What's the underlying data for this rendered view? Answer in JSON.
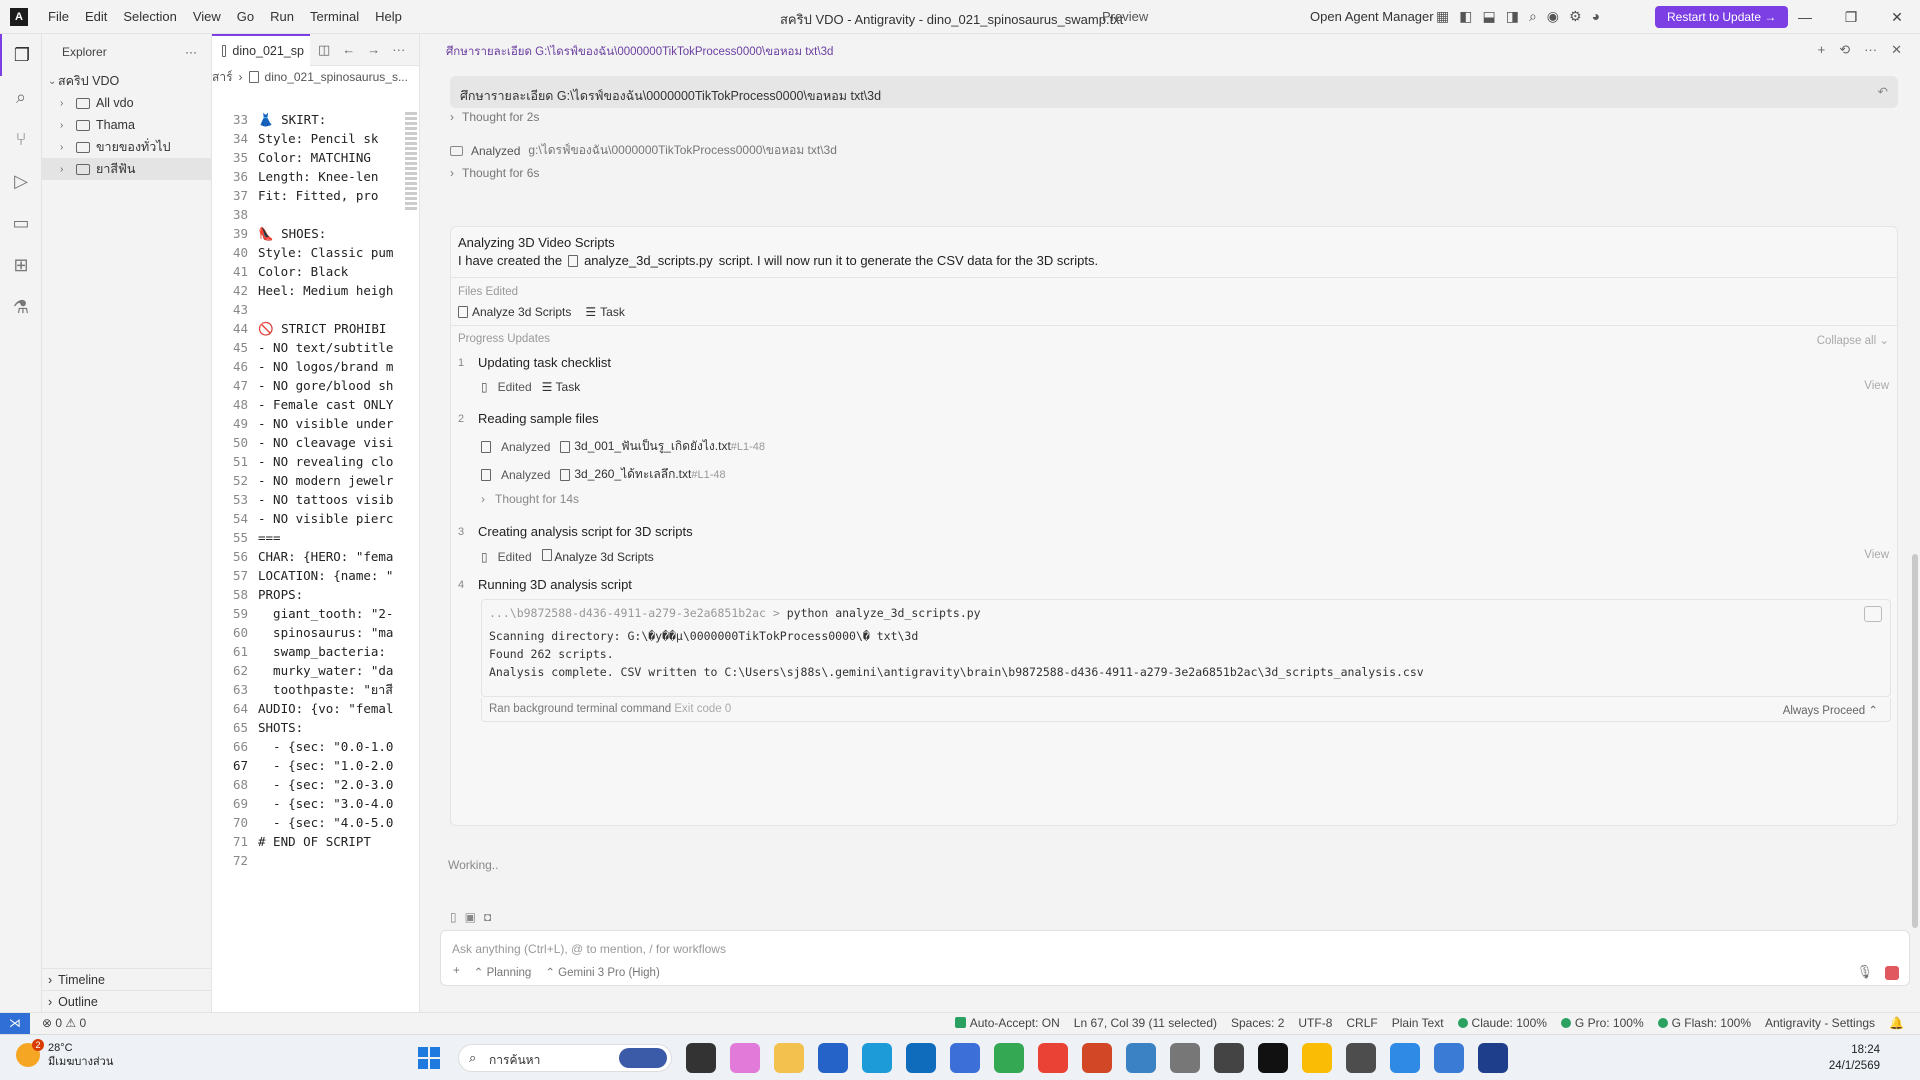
{
  "titlebar": {
    "menu": [
      "File",
      "Edit",
      "Selection",
      "View",
      "Go",
      "Run",
      "Terminal",
      "Help"
    ],
    "title": "สคริป VDO - Antigravity - dino_021_spinosaurus_swamp.txt",
    "preview": "Preview",
    "agent_manager": "Open Agent Manager",
    "restart": "Restart to Update →"
  },
  "sidebar": {
    "title": "Explorer",
    "root": "สคริป VDO",
    "items": [
      {
        "label": "All vdo"
      },
      {
        "label": "Thama"
      },
      {
        "label": "ขายของทั่วไป"
      },
      {
        "label": "ยาสีฟัน"
      }
    ],
    "timeline": "Timeline",
    "outline": "Outline"
  },
  "editor": {
    "tab": "dino_021_sp",
    "breadcrumb_1": "สาร์",
    "breadcrumb_2": "dino_021_spinosaurus_s...",
    "current_line": 67,
    "lines": [
      {
        "n": 33,
        "t": "👗 SKIRT:"
      },
      {
        "n": 34,
        "t": "Style: Pencil sk"
      },
      {
        "n": 35,
        "t": "Color: MATCHING "
      },
      {
        "n": 36,
        "t": "Length: Knee-len"
      },
      {
        "n": 37,
        "t": "Fit: Fitted, pro"
      },
      {
        "n": 38,
        "t": ""
      },
      {
        "n": 39,
        "t": "👠 SHOES:"
      },
      {
        "n": 40,
        "t": "Style: Classic pum"
      },
      {
        "n": 41,
        "t": "Color: Black"
      },
      {
        "n": 42,
        "t": "Heel: Medium heigh"
      },
      {
        "n": 43,
        "t": ""
      },
      {
        "n": 44,
        "t": "🚫 STRICT PROHIBI"
      },
      {
        "n": 45,
        "t": "- NO text/subtitle"
      },
      {
        "n": 46,
        "t": "- NO logos/brand m"
      },
      {
        "n": 47,
        "t": "- NO gore/blood sh"
      },
      {
        "n": 48,
        "t": "- Female cast ONLY"
      },
      {
        "n": 49,
        "t": "- NO visible under"
      },
      {
        "n": 50,
        "t": "- NO cleavage visi"
      },
      {
        "n": 51,
        "t": "- NO revealing clo"
      },
      {
        "n": 52,
        "t": "- NO modern jewelr"
      },
      {
        "n": 53,
        "t": "- NO tattoos visib"
      },
      {
        "n": 54,
        "t": "- NO visible pierc"
      },
      {
        "n": 55,
        "t": "==="
      },
      {
        "n": 56,
        "t": "CHAR: {HERO: \"fema"
      },
      {
        "n": 57,
        "t": "LOCATION: {name: \""
      },
      {
        "n": 58,
        "t": "PROPS:"
      },
      {
        "n": 59,
        "t": "  giant_tooth: \"2-"
      },
      {
        "n": 60,
        "t": "  spinosaurus: \"ma"
      },
      {
        "n": 61,
        "t": "  swamp_bacteria:"
      },
      {
        "n": 62,
        "t": "  murky_water: \"da"
      },
      {
        "n": 63,
        "t": "  toothpaste: \"ยาสี"
      },
      {
        "n": 64,
        "t": "AUDIO: {vo: \"femal"
      },
      {
        "n": 65,
        "t": "SHOTS:"
      },
      {
        "n": 66,
        "t": "  - {sec: \"0.0-1.0"
      },
      {
        "n": 67,
        "t": "  - {sec: \"1.0-2.0"
      },
      {
        "n": 68,
        "t": "  - {sec: \"2.0-3.0"
      },
      {
        "n": 69,
        "t": "  - {sec: \"3.0-4.0"
      },
      {
        "n": 70,
        "t": "  - {sec: \"4.0-5.0"
      },
      {
        "n": 71,
        "t": "# END OF SCRIPT"
      },
      {
        "n": 72,
        "t": ""
      }
    ]
  },
  "agent": {
    "header": "ศึกษารายละเอียด G:\\ไดรฟ์ของฉัน\\0000000TikTokProcess0000\\ขอหอม txt\\3d",
    "query": "ศึกษารายละเอียด G:\\ไดรฟ์ของฉัน\\0000000TikTokProcess0000\\ขอหอม txt\\3d",
    "thought1": "Thought for 2s",
    "analyzed_label": "Analyzed",
    "analyzed_path": "g:\\ไดรฟ์ของฉัน\\0000000TikTokProcess0000\\ขอหอม txt\\3d",
    "thought2": "Thought for 6s",
    "card_title": "Analyzing 3D Video Scripts",
    "card_desc_pre": "I have created the",
    "card_desc_file": "analyze_3d_scripts.py",
    "card_desc_post": "script. I will now run it to generate the CSV data for the 3D scripts.",
    "files_edited_label": "Files Edited",
    "file_chip_1": "Analyze 3d Scripts",
    "file_chip_2": "Task",
    "progress_label": "Progress Updates",
    "collapse_all": "Collapse all",
    "steps": [
      {
        "num": "1",
        "title": "Updating task checklist"
      },
      {
        "num": "2",
        "title": "Reading sample files"
      },
      {
        "num": "3",
        "title": "Creating analysis script for 3D scripts"
      },
      {
        "num": "4",
        "title": "Running 3D analysis script"
      }
    ],
    "s1_action": "Edited",
    "s1_target": "Task",
    "view_label": "View",
    "s2_a_action": "Analyzed",
    "s2_a_file": "3d_001_ฟันเป็นรู_เกิดยังไง.txt",
    "s2_a_range": "#L1-48",
    "s2_b_action": "Analyzed",
    "s2_b_file": "3d_260_ได้ทะเลลึก.txt",
    "s2_b_range": "#L1-48",
    "s2_thought": "Thought for 14s",
    "s3_action": "Edited",
    "s3_target": "Analyze 3d Scripts",
    "term_cwd": "...\\b9872588-d436-4911-a279-3e2a6851b2ac >",
    "term_cmd": "python analyze_3d_scripts.py",
    "term_out_1": "Scanning directory: G:\\�y��µ\\0000000TikTokProcess0000\\� txt\\3d",
    "term_out_2": "Found 262 scripts.",
    "term_out_3": "Analysis complete. CSV written to C:\\Users\\sj88s\\.gemini\\antigravity\\brain\\b9872588-d436-4911-a279-3e2a6851b2ac\\3d_scripts_analysis.csv",
    "term_foot": "Ran background terminal command",
    "term_exit": "Exit code 0",
    "always_proceed": "Always Proceed",
    "working": "Working..",
    "input_placeholder": "Ask anything (Ctrl+L), @ to mention, / for workflows",
    "mode": "Planning",
    "model": "Gemini 3 Pro (High)"
  },
  "statusbar": {
    "problems": "⊗ 0 ⚠ 0",
    "auto_accept": "Auto-Accept: ON",
    "position": "Ln 67, Col 39 (11 selected)",
    "spaces": "Spaces: 2",
    "encoding": "UTF-8",
    "eol": "CRLF",
    "lang": "Plain Text",
    "claude": "Claude: 100%",
    "gpro": "G Pro: 100%",
    "gflash": "G Flash: 100%",
    "settings": "Antigravity - Settings"
  },
  "taskbar": {
    "badge": "2",
    "temp": "28°C",
    "weather": "มีเมฆบางส่วน",
    "search": "การค้นหา",
    "time": "18:24",
    "date": "24/1/2569"
  },
  "colors": {
    "accent": "#7b3fe4",
    "status_green": "#2aa160",
    "stop_red": "#e2585f"
  }
}
